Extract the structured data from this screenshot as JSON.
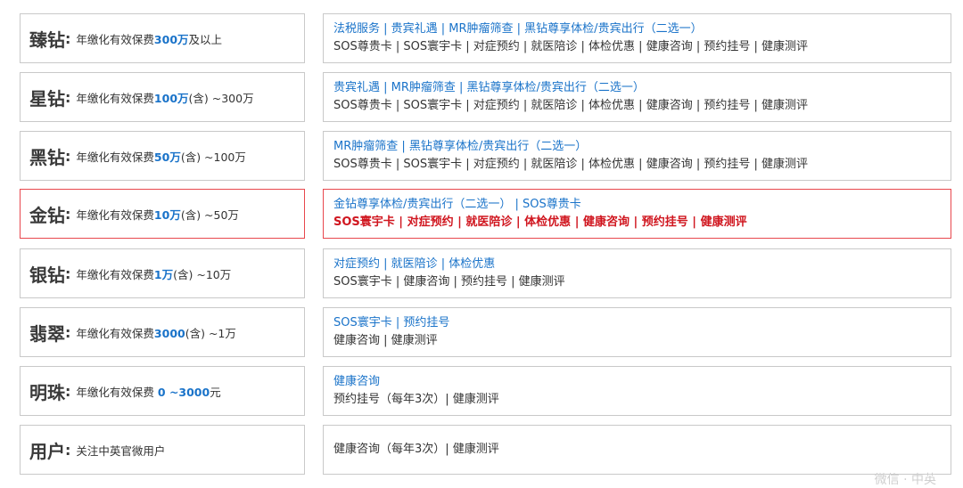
{
  "rows": [
    {
      "tier": "臻钻",
      "desc_prefix": "年缴化有效保费",
      "desc_amount": "300万",
      "desc_suffix": "及以上",
      "line1": "法税服务 | 贵宾礼遇 | MR肿瘤筛查 | 黑钻尊享体检/贵宾出行（二选一）",
      "line2": "SOS尊贵卡 | SOS寰宇卡 | 对症预约 | 就医陪诊 | 体检优惠 | 健康咨询 | 预约挂号 | 健康测评"
    },
    {
      "tier": "星钻",
      "desc_prefix": "年缴化有效保费",
      "desc_amount": "100万",
      "desc_suffix": "(含) ~300万",
      "line1": "贵宾礼遇 | MR肿瘤筛查 | 黑钻尊享体检/贵宾出行（二选一）",
      "line2": "SOS尊贵卡 | SOS寰宇卡 | 对症预约 | 就医陪诊 | 体检优惠 | 健康咨询 | 预约挂号 | 健康测评"
    },
    {
      "tier": "黑钻",
      "desc_prefix": "年缴化有效保费",
      "desc_amount": "50万",
      "desc_suffix": "(含) ~100万",
      "line1": "MR肿瘤筛查 | 黑钻尊享体检/贵宾出行（二选一）",
      "line2": "SOS尊贵卡 | SOS寰宇卡 | 对症预约 | 就医陪诊 | 体检优惠 | 健康咨询 | 预约挂号 | 健康测评"
    },
    {
      "tier": "金钻",
      "desc_prefix": "年缴化有效保费",
      "desc_amount": "10万",
      "desc_suffix": "(含) ~50万",
      "line1": "金钻尊享体检/贵宾出行（二选一） | SOS尊贵卡",
      "line2": "SOS寰宇卡 | 对症预约 | 就医陪诊 | 体检优惠 | 健康咨询 | 预约挂号 | 健康测评"
    },
    {
      "tier": "银钻",
      "desc_prefix": "年缴化有效保费",
      "desc_amount": "1万",
      "desc_suffix": "(含) ~10万",
      "line1": "对症预约 | 就医陪诊 | 体检优惠",
      "line2": "SOS寰宇卡 | 健康咨询 | 预约挂号 | 健康测评"
    },
    {
      "tier": "翡翠",
      "desc_prefix": "年缴化有效保费",
      "desc_amount": "3000",
      "desc_suffix": "(含) ~1万",
      "line1": "SOS寰宇卡 | 预约挂号",
      "line2": "健康咨询 | 健康测评"
    },
    {
      "tier": "明珠",
      "desc_prefix": "年缴化有效保费 ",
      "desc_amount": "0 ~3000",
      "desc_suffix": "元",
      "line1": "健康咨询",
      "line2": "预约挂号（每年3次）| 健康测评"
    },
    {
      "tier": "用户",
      "desc_prefix": "关注中英官微用户",
      "desc_amount": "",
      "desc_suffix": "",
      "line1": "健康咨询（每年3次）| 健康测评",
      "line2": ""
    }
  ],
  "colors": {
    "accent_blue": "#1a73c9",
    "highlight_red": "#d0161f",
    "highlight_border": "#e8474d",
    "border": "#c9c9c9"
  },
  "watermark": "微信 · 中英"
}
